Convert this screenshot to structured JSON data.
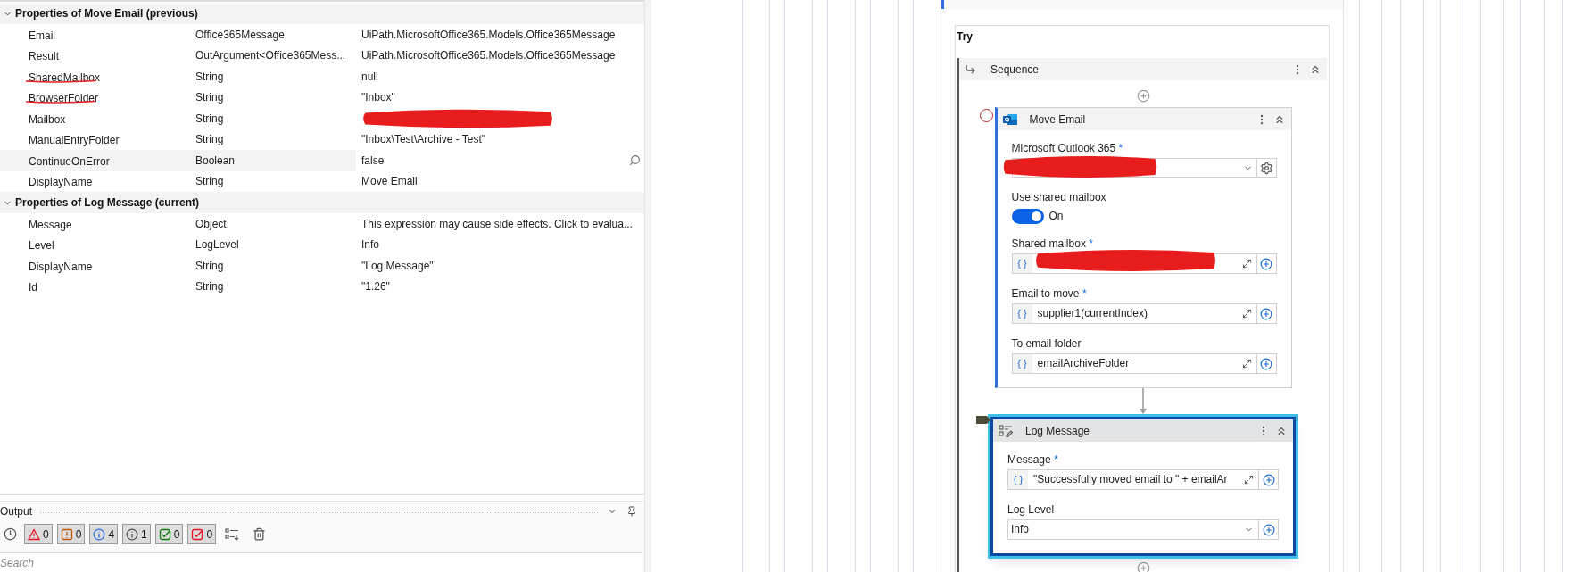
{
  "properties": {
    "sections": [
      {
        "title": "Properties of Move Email (previous)",
        "expanded": true,
        "rows": [
          {
            "name": "Email",
            "type": "Office365Message",
            "value": "UiPath.MicrosoftOffice365.Models.Office365Message",
            "selected": false,
            "underlined": false,
            "redacted": false
          },
          {
            "name": "Result",
            "type": "OutArgument<Office365Mess...",
            "value": "UiPath.MicrosoftOffice365.Models.Office365Message",
            "selected": false,
            "underlined": false,
            "redacted": false
          },
          {
            "name": "SharedMailbox",
            "type": "String",
            "value": "null",
            "selected": false,
            "underlined": true,
            "redacted": false
          },
          {
            "name": "BrowserFolder",
            "type": "String",
            "value": "\"Inbox\"",
            "selected": false,
            "underlined": true,
            "redacted": false
          },
          {
            "name": "Mailbox",
            "type": "String",
            "selected": false,
            "underlined": false,
            "redacted": true
          },
          {
            "name": "ManualEntryFolder",
            "type": "String",
            "value": "\"Inbox\\Test\\Archive - Test\"",
            "selected": false,
            "underlined": false,
            "redacted": false
          },
          {
            "name": "ContinueOnError",
            "type": "Boolean",
            "value": "false",
            "selected": true,
            "underlined": false,
            "redacted": false
          },
          {
            "name": "DisplayName",
            "type": "String",
            "value": "Move Email",
            "selected": false,
            "underlined": false,
            "redacted": false
          }
        ]
      },
      {
        "title": "Properties of Log Message (current)",
        "expanded": true,
        "rows": [
          {
            "name": "Message",
            "type": "Object",
            "value": "This expression may cause side effects. Click to evalua...",
            "selected": false,
            "underlined": false,
            "redacted": false
          },
          {
            "name": "Level",
            "type": "LogLevel",
            "value": "Info",
            "selected": false,
            "underlined": false,
            "redacted": false
          },
          {
            "name": "DisplayName",
            "type": "String",
            "value": "\"Log Message\"",
            "selected": false,
            "underlined": false,
            "redacted": false
          },
          {
            "name": "Id",
            "type": "String",
            "value": "\"1.26\"",
            "selected": false,
            "underlined": false,
            "redacted": false
          }
        ]
      }
    ]
  },
  "output": {
    "title": "Output",
    "filters": [
      {
        "kind": "error",
        "count": "0",
        "color": "#e81123"
      },
      {
        "kind": "warning",
        "count": "0",
        "color": "#c05a00"
      },
      {
        "kind": "info",
        "count": "4",
        "color": "#2f6fde"
      },
      {
        "kind": "trace",
        "count": "1",
        "color": "#555555"
      },
      {
        "kind": "success",
        "count": "0",
        "color": "#107c10"
      },
      {
        "kind": "failure",
        "count": "0",
        "color": "#e81123"
      }
    ],
    "search": {
      "placeholder": "Search"
    }
  },
  "canvas": {
    "try_label": "Try",
    "sequence": {
      "title": "Sequence"
    },
    "activities": [
      {
        "title": "Move Email",
        "kind": "email",
        "current": false,
        "breakpoint": true,
        "fields": [
          {
            "kind": "connection",
            "label": "Microsoft Outlook 365",
            "required_mark": "*",
            "redacted": true
          },
          {
            "kind": "toggle",
            "label": "Use shared mailbox",
            "on": true,
            "state_text": "On"
          },
          {
            "kind": "expression",
            "label": "Shared mailbox",
            "required_mark": "*",
            "prefix": "{ }",
            "redacted": true
          },
          {
            "kind": "expression",
            "label": "Email to move",
            "required_mark": "*",
            "prefix": "{ }",
            "redacted": false,
            "value": "supplier1(currentIndex)"
          },
          {
            "kind": "expression",
            "label": "To email folder",
            "prefix": "{ }",
            "redacted": false,
            "value": "emailArchiveFolder"
          }
        ]
      },
      {
        "title": "Log Message",
        "kind": "log",
        "current": true,
        "breakpoint": false,
        "fields": [
          {
            "kind": "expression",
            "label": "Message",
            "required_mark": "*",
            "prefix": "{ }",
            "redacted": false,
            "value": "\"Successfully moved email to \" + emailAr"
          },
          {
            "kind": "dropdown",
            "label": "Log Level",
            "value": "Info"
          }
        ]
      }
    ]
  }
}
